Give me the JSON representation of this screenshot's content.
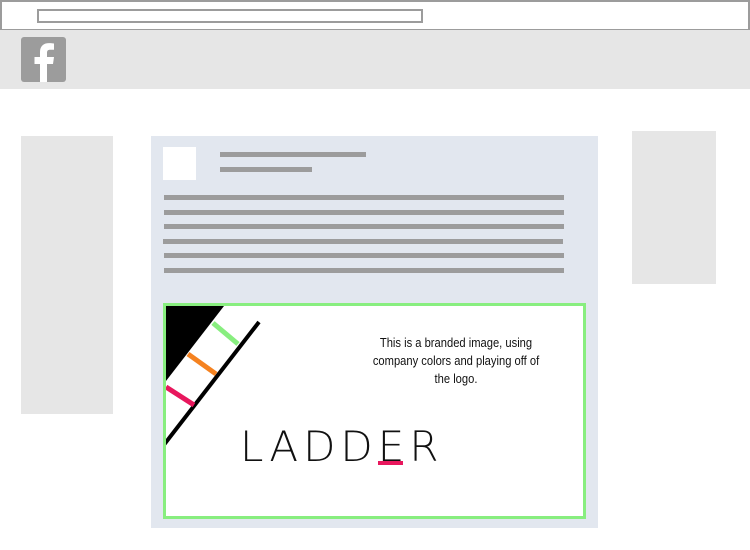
{
  "browser": {
    "url": ""
  },
  "header": {
    "logo_icon": "facebook-f-icon",
    "logo_bg": "#9c9c9c"
  },
  "post": {
    "branded_image": {
      "caption": "This is a branded image, using company colors and playing off of the logo.",
      "wordmark": "LADDER",
      "border_color": "#88ee7f",
      "accent_colors": [
        "#88ee7f",
        "#f58220",
        "#e8175d"
      ]
    }
  }
}
